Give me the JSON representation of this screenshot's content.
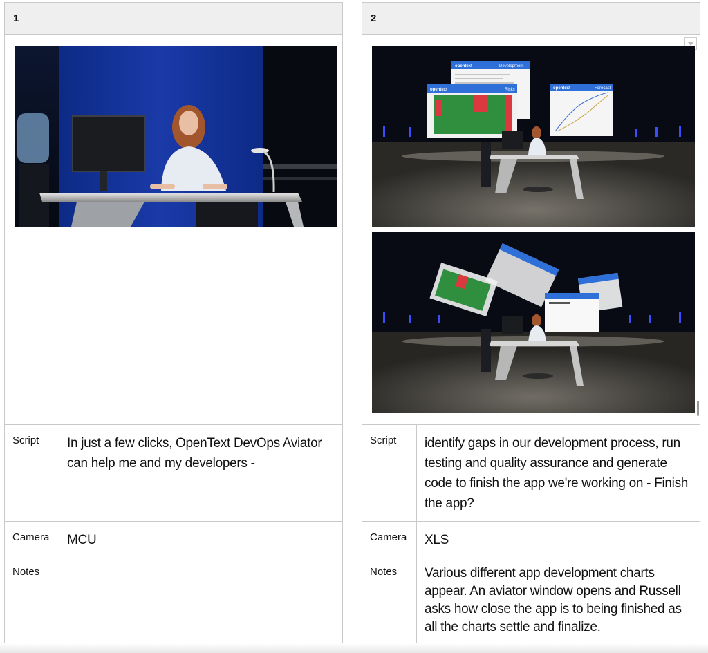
{
  "panels": [
    {
      "number": "1",
      "images": [
        "presenter-at-desk-medium-close-up"
      ],
      "labels": {
        "script": "Script",
        "camera": "Camera",
        "notes": "Notes"
      },
      "script": "In just a few clicks, OpenText DevOps Aviator can help me and my developers -",
      "camera": "MCU",
      "notes": ""
    },
    {
      "number": "2",
      "images": [
        "presenter-with-floating-app-windows",
        "floating-windows-settling"
      ],
      "labels": {
        "script": "Script",
        "camera": "Camera",
        "notes": "Notes"
      },
      "script": "identify gaps in our development process, run testing and quality assurance and generate code to finish the app we're working on - Finish the app?",
      "camera": "XLS",
      "notes": "Various different app development charts appear.  An aviator window opens and Russell asks how close the app is to being finished as all the charts settle and finalize."
    }
  ],
  "scene_windows": {
    "brand": "opentext",
    "development": "Development",
    "risks": "Risks",
    "forecast": "Forecast"
  },
  "icons": [
    "dropdown-chevron-icon"
  ],
  "colors": {
    "border": "#c9c9c9",
    "header_bg": "#efefef",
    "window_blue": "#2f6fd8",
    "chart_green": "#2f8f3f",
    "chart_red": "#d9393f",
    "backdrop_blue": "#123a9c"
  }
}
